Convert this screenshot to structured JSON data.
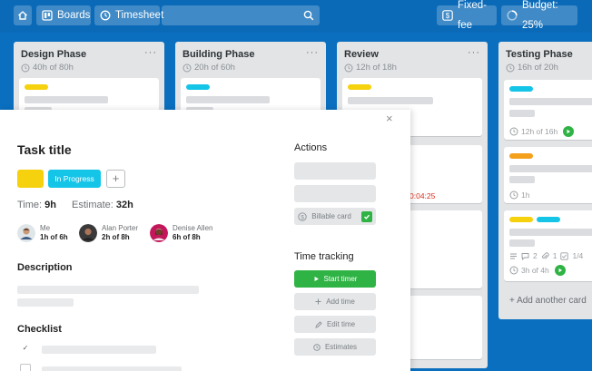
{
  "topbar": {
    "boards_label": "Boards",
    "timesheet_label": "Timesheet",
    "fixed_fee_label": "Fixed-fee",
    "budget_label": "Budget: 25%"
  },
  "lists": [
    {
      "title": "Design Phase",
      "sub": "40h of 80h"
    },
    {
      "title": "Building Phase",
      "sub": "20h of 60h"
    },
    {
      "title": "Review",
      "sub": "12h of 18h"
    },
    {
      "title": "Testing Phase",
      "sub": "16h of 20h"
    }
  ],
  "testing_cards": {
    "card1_time": "12h of 16h",
    "card2_time": "1h",
    "card3_comments": "2",
    "card3_attachments": "1",
    "card3_checklist": "1/4",
    "card3_time": "3h of 4h"
  },
  "review_timer": "0:04:25",
  "add_card_label": "+ Add another card",
  "modal": {
    "close_label": "×",
    "task_title": "Task title",
    "status_label": "In Progress",
    "add_label_btn": "+",
    "time_label": "Time:",
    "time_value": "9h",
    "estimate_label": "Estimate:",
    "estimate_value": "32h",
    "members": [
      {
        "name": "Me",
        "hours": "1h of 6h"
      },
      {
        "name": "Alan Porter",
        "hours": "2h of 8h"
      },
      {
        "name": "Denise Allen",
        "hours": "6h of 8h"
      }
    ],
    "description_heading": "Description",
    "checklist_heading": "Checklist",
    "checklist_first_mark": "✓",
    "actions_heading": "Actions",
    "billable_label": "Billable card",
    "time_tracking_heading": "Time tracking",
    "start_timer_label": "Start timer",
    "add_time_label": "Add time",
    "edit_time_label": "Edit time",
    "estimates_label": "Estimates"
  },
  "colors": {
    "background": "#0a6fbf",
    "label_yellow": "#f6d10d",
    "label_cyan": "#15c5e8",
    "label_orange": "#f5a01d",
    "timer_green": "#2fb344",
    "timer_red": "#d8301f"
  },
  "icons": {
    "home": "home-icon",
    "boards": "boards-icon",
    "timesheet": "clock-icon",
    "search": "search-icon",
    "fixed_fee": "dollar-icon",
    "budget": "pie-icon"
  }
}
